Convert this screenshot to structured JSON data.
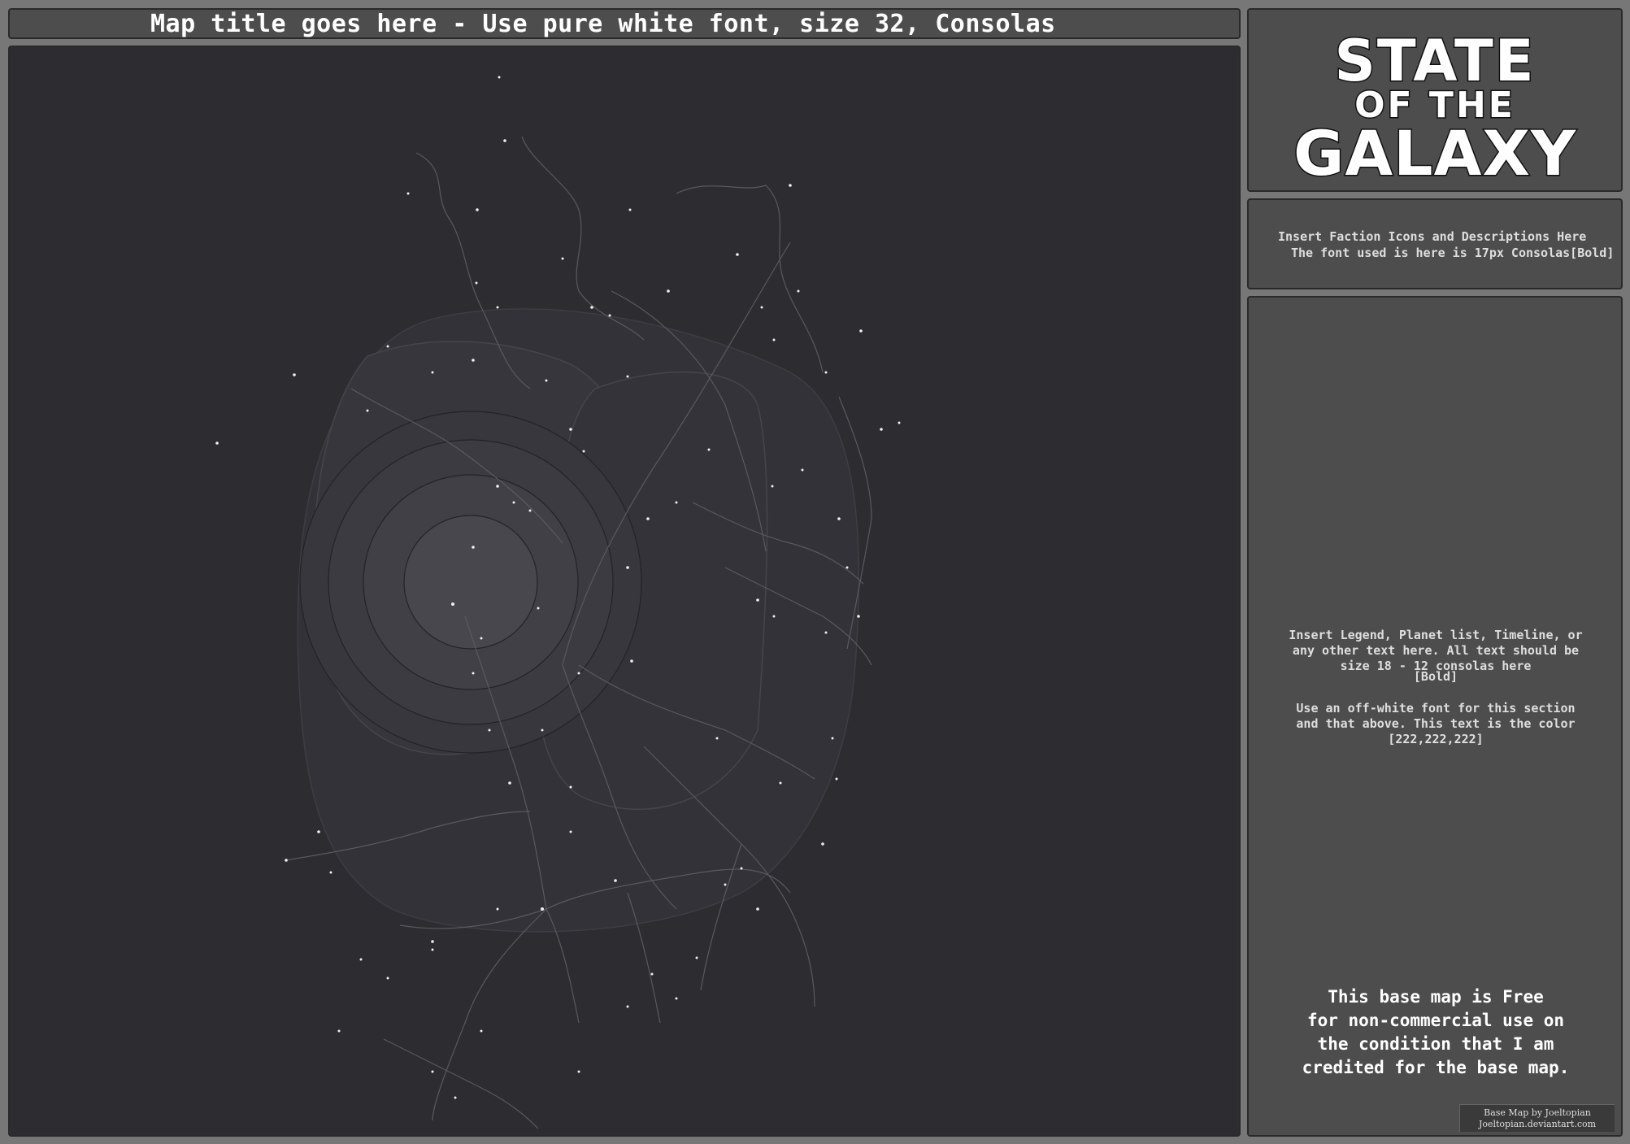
{
  "title": "Map title goes here - Use pure white font, size 32, Consolas",
  "logo": {
    "line1": "STATE",
    "line2": "OF THE",
    "line3": "GALAXY"
  },
  "faction": {
    "line1": "Insert Faction Icons and Descriptions Here",
    "line2": "The font used is here is 17px Consolas[Bold]"
  },
  "legend": {
    "para1_line1": "Insert Legend, Planet list, Timeline, or",
    "para1_line2": "any other text here. All text should be",
    "para1_line3": "size 18 - 12 consolas here",
    "para1_line4": "[Bold]",
    "para2_line1": "Use an off-white font for this section",
    "para2_line2": "and that above. This text is the color",
    "para2_line3": "[222,222,222]"
  },
  "license": {
    "line1": "This base map is Free",
    "line2": "for non-commercial use on",
    "line3": "the condition that I am",
    "line4": "credited for the base map."
  },
  "credit": {
    "line1": "Base Map by Joeltopian",
    "line2": "Joeltopian.deviantart.com"
  },
  "colors": {
    "frame": "#777777",
    "panel": "#4d4d4d",
    "map_background": "#2d2c31",
    "title_text": "#ffffff",
    "off_white_text": "#dedede"
  }
}
